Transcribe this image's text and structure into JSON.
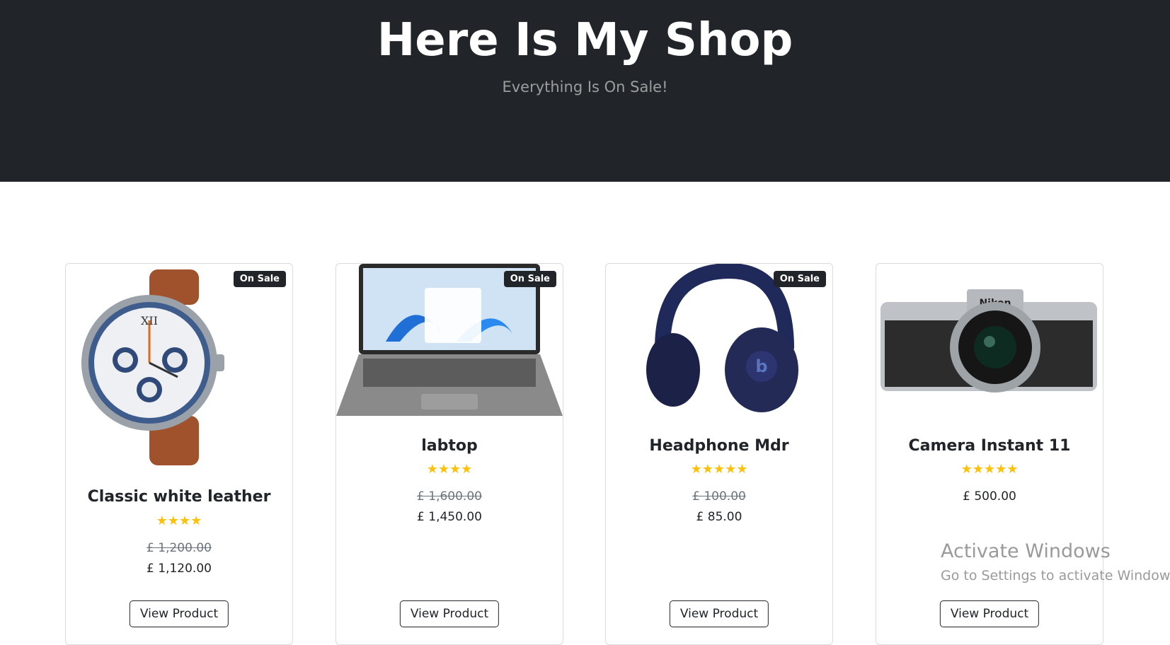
{
  "header": {
    "title": "Here Is My Shop",
    "subtitle": "Everything Is On Sale!"
  },
  "products": [
    {
      "name": "Classic white leather",
      "badge": "On Sale",
      "rating": 4,
      "stars": "★★★★",
      "old_price": "£ 1,200.00",
      "price": "£ 1,120.00",
      "button": "View Product",
      "image": "watch-image"
    },
    {
      "name": "labtop",
      "badge": "On Sale",
      "rating": 4,
      "stars": "★★★★",
      "old_price": "£ 1,600.00",
      "price": "£ 1,450.00",
      "button": "View Product",
      "image": "laptop-image"
    },
    {
      "name": "Headphone Mdr",
      "badge": "On Sale",
      "rating": 5,
      "stars": "★★★★★",
      "old_price": "£ 100.00",
      "price": "£ 85.00",
      "button": "View Product",
      "image": "headphones-image"
    },
    {
      "name": "Camera Instant 11",
      "rating": 5,
      "stars": "★★★★★",
      "price": "£ 500.00",
      "button": "View Product",
      "image": "camera-image"
    }
  ],
  "watermark": {
    "line1": "Activate Windows",
    "line2": "Go to Settings to activate Windows."
  },
  "colors": {
    "hero_bg": "#212529",
    "star": "#ffc107",
    "badge_bg": "#212529"
  }
}
